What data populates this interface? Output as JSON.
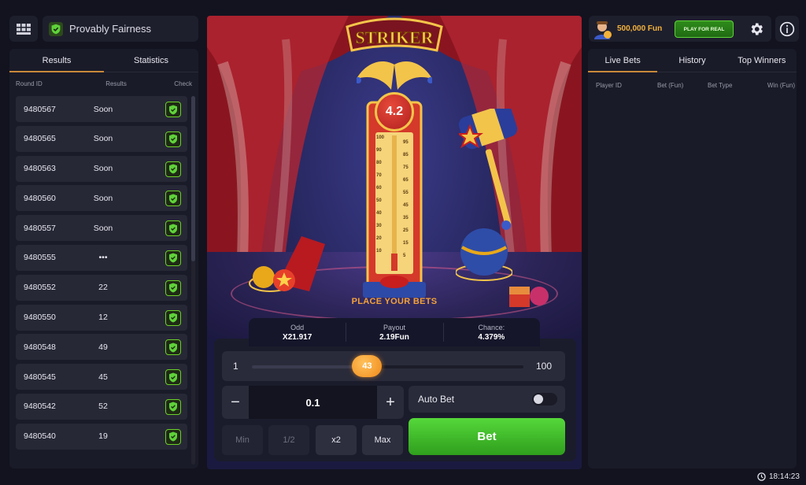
{
  "header": {
    "fairness_label": "Provably Fairness"
  },
  "left_tabs": [
    {
      "label": "Results",
      "active": true
    },
    {
      "label": "Statistics",
      "active": false
    }
  ],
  "left_columns": {
    "round_id": "Round ID",
    "results": "Results",
    "check": "Check"
  },
  "rounds": [
    {
      "id": "9480567",
      "result": "Soon"
    },
    {
      "id": "9480565",
      "result": "Soon"
    },
    {
      "id": "9480563",
      "result": "Soon"
    },
    {
      "id": "9480560",
      "result": "Soon"
    },
    {
      "id": "9480557",
      "result": "Soon"
    },
    {
      "id": "9480555",
      "result": "•••"
    },
    {
      "id": "9480552",
      "result": "22"
    },
    {
      "id": "9480550",
      "result": "12"
    },
    {
      "id": "9480548",
      "result": "49"
    },
    {
      "id": "9480545",
      "result": "45"
    },
    {
      "id": "9480542",
      "result": "52"
    },
    {
      "id": "9480540",
      "result": "19"
    }
  ],
  "game": {
    "title": "STRIKER",
    "current_odd": "4.2",
    "scale_left": [
      "100",
      "90",
      "80",
      "70",
      "60",
      "50",
      "40",
      "30",
      "20",
      "10"
    ],
    "scale_right": [
      "95",
      "85",
      "75",
      "65",
      "55",
      "45",
      "35",
      "25",
      "15",
      "5"
    ],
    "status_text": "PLACE YOUR BETS"
  },
  "stats": {
    "odd_label": "Odd",
    "odd_value": "X21.917",
    "payout_label": "Payout",
    "payout_value": "2.19Fun",
    "chance_label": "Chance:",
    "chance_value": "4.379%"
  },
  "slider": {
    "min": "1",
    "max": "100",
    "value": 43,
    "display": "43"
  },
  "bet_amount": {
    "value": "0.1",
    "minus": "−",
    "plus": "+"
  },
  "auto_bet": {
    "label": "Auto Bet",
    "enabled": false
  },
  "quick_buttons": [
    {
      "label": "Min",
      "enabled": false
    },
    {
      "label": "1/2",
      "enabled": false
    },
    {
      "label": "x2",
      "enabled": true
    },
    {
      "label": "Max",
      "enabled": true
    }
  ],
  "bet_button": {
    "label": "Bet"
  },
  "account": {
    "balance": "500,000 Fun",
    "play_real_label": "PLAY FOR REAL"
  },
  "right_tabs": [
    {
      "label": "Live Bets",
      "active": true
    },
    {
      "label": "History",
      "active": false
    },
    {
      "label": "Top Winners",
      "active": false
    }
  ],
  "right_columns": {
    "player": "Player ID",
    "bet": "Bet (Fun)",
    "type": "Bet Type",
    "win": "Win (Fun)"
  },
  "clock": "18:14:23",
  "colors": {
    "accent": "#c9883a",
    "bet_green": "#3fb82a",
    "balance_gold": "#f3b23a",
    "status_orange": "#f3a23a"
  }
}
